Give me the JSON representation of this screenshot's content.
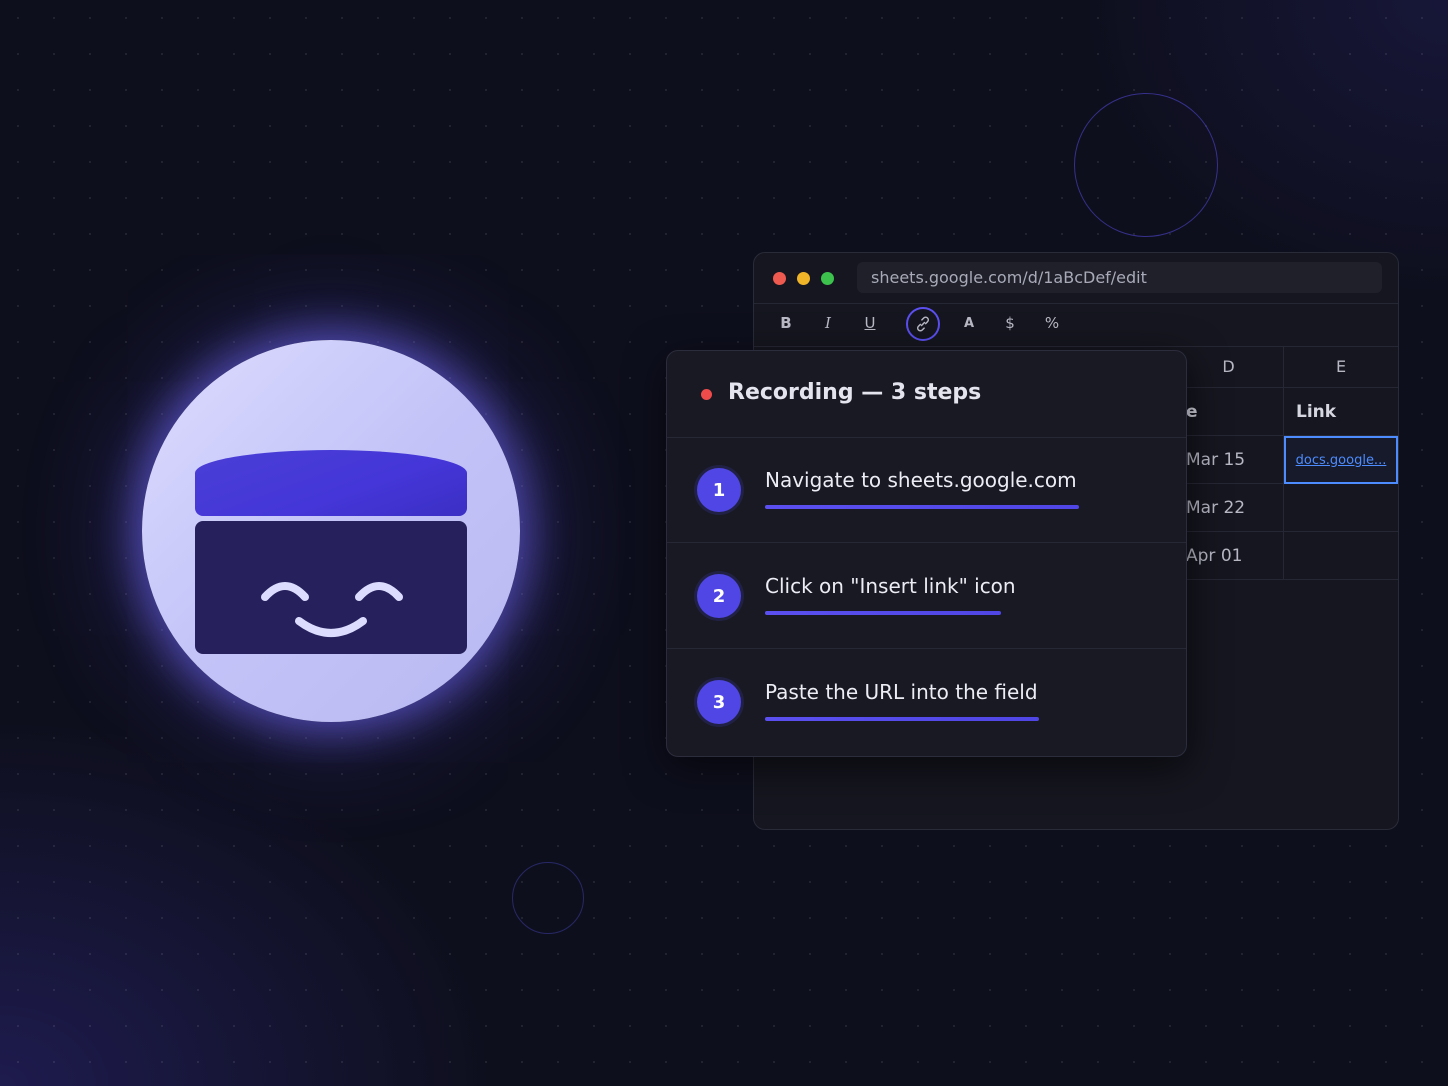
{
  "browser": {
    "url": "sheets.google.com/d/1aBcDef/edit",
    "toolbar": {
      "bold": "B",
      "italic": "I",
      "underline": "U",
      "text_color": "A",
      "currency": "$",
      "percent": "%"
    }
  },
  "sheet": {
    "columns": [
      "D",
      "E"
    ],
    "header_row": {
      "d": "e",
      "e": "Link"
    },
    "rows": [
      {
        "d": "Mar 15",
        "e": "docs.google..."
      },
      {
        "d": "Mar 22",
        "e": ""
      },
      {
        "d": "Apr 01",
        "e": ""
      }
    ]
  },
  "recording": {
    "title": "Recording — 3 steps",
    "steps": [
      {
        "number": "1",
        "label": "Navigate to sheets.google.com",
        "progress": 1.0
      },
      {
        "number": "2",
        "label": "Click on \"Insert link\" icon",
        "progress": 1.0
      },
      {
        "number": "3",
        "label": "Paste the URL into the field",
        "progress": 1.0
      }
    ]
  },
  "colors": {
    "accent": "#4f46e5",
    "record": "#ef4b4b",
    "link": "#4d8cff",
    "background": "#0e0f1d"
  }
}
